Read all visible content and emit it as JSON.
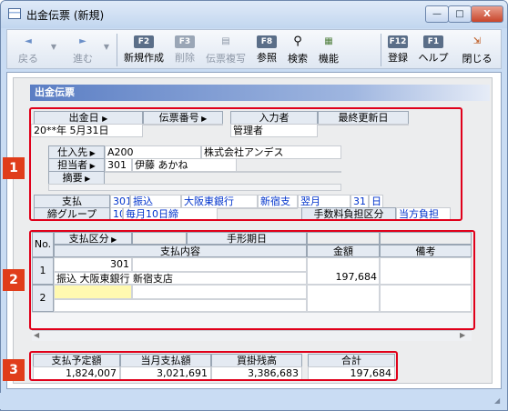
{
  "window": {
    "title": "出金伝票 (新規)",
    "min_label": "—",
    "max_label": "□",
    "close_label": "X"
  },
  "toolbar": {
    "back": {
      "icon": "◄",
      "label": "戻る"
    },
    "forward": {
      "icon": "►",
      "label": "進む"
    },
    "new": {
      "key": "F2",
      "label": "新規作成"
    },
    "delete": {
      "key": "F3",
      "label": "削除"
    },
    "copy": {
      "label": "伝票複写"
    },
    "ref": {
      "key": "F8",
      "label": "参照"
    },
    "search": {
      "label": "検索"
    },
    "func": {
      "label": "機能"
    },
    "register": {
      "key": "F12",
      "label": "登録"
    },
    "help": {
      "key": "F1",
      "label": "ヘルプ"
    },
    "close": {
      "label": "閉じる"
    }
  },
  "page_title": "出金伝票",
  "header": {
    "date_label": "出金日",
    "slip_label": "伝票番号",
    "input_label": "入力者",
    "updated_label": "最終更新日",
    "date_value": "20**年 5月31日",
    "slip_value": "",
    "input_value": "管理者",
    "updated_value": "",
    "vendor_label": "仕入先",
    "vendor_code": "A200",
    "vendor_name": "株式会社アンデス",
    "staff_label": "担当者",
    "staff_code": "301",
    "staff_name": "伊藤 あかね",
    "memo_label": "摘要",
    "pay_label": "支払",
    "pay_code": "301",
    "pay_method": "振込",
    "pay_bank": "大阪東銀行",
    "pay_branch": "新宿支",
    "pay_month": "翌月",
    "pay_day_num": "31",
    "pay_day_unit": "日",
    "closing_label": "締グループ",
    "closing_num": "10",
    "closing_value": "毎月10日締",
    "fee_label": "手数料負担区分",
    "fee_value": "当方負担"
  },
  "grid": {
    "no_label": "No.",
    "payclass_label": "支払区分",
    "due_label": "手形期日",
    "detail_label": "支払内容",
    "amount_label": "金額",
    "note_label": "備考",
    "rows": [
      {
        "no": "1",
        "code": "301",
        "detail": "振込     大阪東銀行  新宿支店",
        "amount": "197,684",
        "note": ""
      },
      {
        "no": "2",
        "code": "",
        "detail": "",
        "amount": "",
        "note": ""
      }
    ]
  },
  "totals": {
    "scheduled_label": "支払予定額",
    "scheduled_value": "1,824,007",
    "month_label": "当月支払額",
    "month_value": "3,021,691",
    "balance_label": "買掛残高",
    "balance_value": "3,386,683",
    "total_label": "合計",
    "total_value": "197,684"
  },
  "badges": {
    "b1": "1",
    "b2": "2",
    "b3": "3"
  },
  "colors": {
    "highlight": "#e0001a",
    "badge": "#e03d1b",
    "title_band": "#5b7ec4",
    "link_blue": "#0033cc",
    "active_cell": "#fff9b0"
  }
}
